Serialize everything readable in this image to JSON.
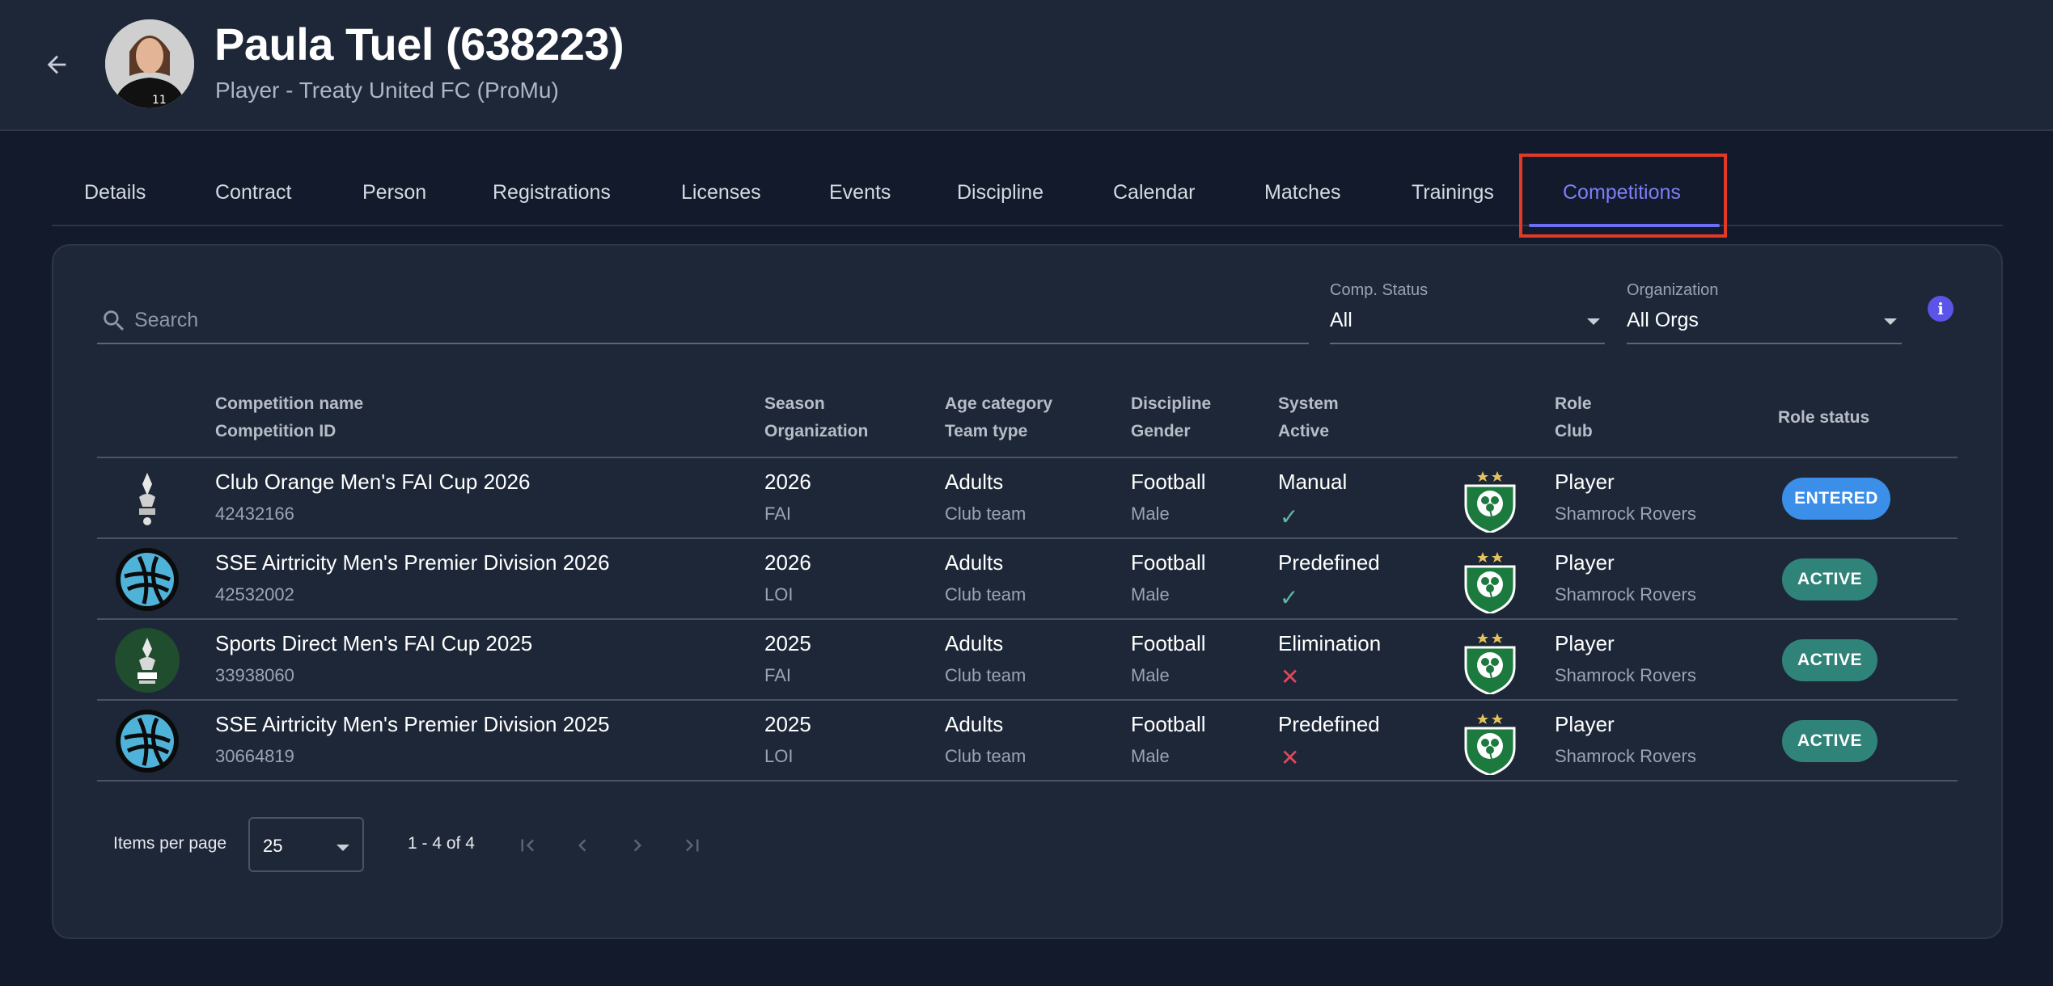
{
  "header": {
    "name": "Paula Tuel (638223)",
    "subtitle": "Player - Treaty United FC (ProMu)"
  },
  "tabs": [
    {
      "label": "Details"
    },
    {
      "label": "Contract"
    },
    {
      "label": "Person"
    },
    {
      "label": "Registrations"
    },
    {
      "label": "Licenses"
    },
    {
      "label": "Events"
    },
    {
      "label": "Discipline"
    },
    {
      "label": "Calendar"
    },
    {
      "label": "Matches"
    },
    {
      "label": "Trainings"
    },
    {
      "label": "Competitions",
      "active": true
    }
  ],
  "filters": {
    "search_placeholder": "Search",
    "comp_status_label": "Comp. Status",
    "comp_status_value": "All",
    "organization_label": "Organization",
    "organization_value": "All Orgs"
  },
  "columns": {
    "name_1": "Competition name",
    "name_2": "Competition ID",
    "season_1": "Season",
    "season_2": "Organization",
    "age_1": "Age category",
    "age_2": "Team type",
    "disc_1": "Discipline",
    "disc_2": "Gender",
    "sys_1": "System",
    "sys_2": "Active",
    "role_1": "Role",
    "role_2": "Club",
    "role_status": "Role status"
  },
  "rows": [
    {
      "name": "Club Orange Men's FAI Cup 2026",
      "id": "42432166",
      "season": "2026",
      "org": "FAI",
      "age": "Adults",
      "team_type": "Club team",
      "discipline": "Football",
      "gender": "Male",
      "system": "Manual",
      "active": true,
      "role": "Player",
      "club": "Shamrock Rovers",
      "status": "ENTERED",
      "logo": "fai-cup-icon"
    },
    {
      "name": "SSE Airtricity Men's Premier Division 2026",
      "id": "42532002",
      "season": "2026",
      "org": "LOI",
      "age": "Adults",
      "team_type": "Club team",
      "discipline": "Football",
      "gender": "Male",
      "system": "Predefined",
      "active": true,
      "role": "Player",
      "club": "Shamrock Rovers",
      "status": "ACTIVE",
      "logo": "loi-icon"
    },
    {
      "name": "Sports Direct Men's FAI Cup 2025",
      "id": "33938060",
      "season": "2025",
      "org": "FAI",
      "age": "Adults",
      "team_type": "Club team",
      "discipline": "Football",
      "gender": "Male",
      "system": "Elimination",
      "active": false,
      "role": "Player",
      "club": "Shamrock Rovers",
      "status": "ACTIVE",
      "logo": "fai-cup-green-icon"
    },
    {
      "name": "SSE Airtricity Men's Premier Division 2025",
      "id": "30664819",
      "season": "2025",
      "org": "LOI",
      "age": "Adults",
      "team_type": "Club team",
      "discipline": "Football",
      "gender": "Male",
      "system": "Predefined",
      "active": false,
      "role": "Player",
      "club": "Shamrock Rovers",
      "status": "ACTIVE",
      "logo": "loi-icon"
    }
  ],
  "paginator": {
    "items_per_page_label": "Items per page",
    "items_per_page": "25",
    "range": "1 - 4 of 4"
  },
  "colors": {
    "accent": "#7c7ff8",
    "entered": "#3b8fe8",
    "active": "#2f8379",
    "highlight": "#e23a27"
  }
}
